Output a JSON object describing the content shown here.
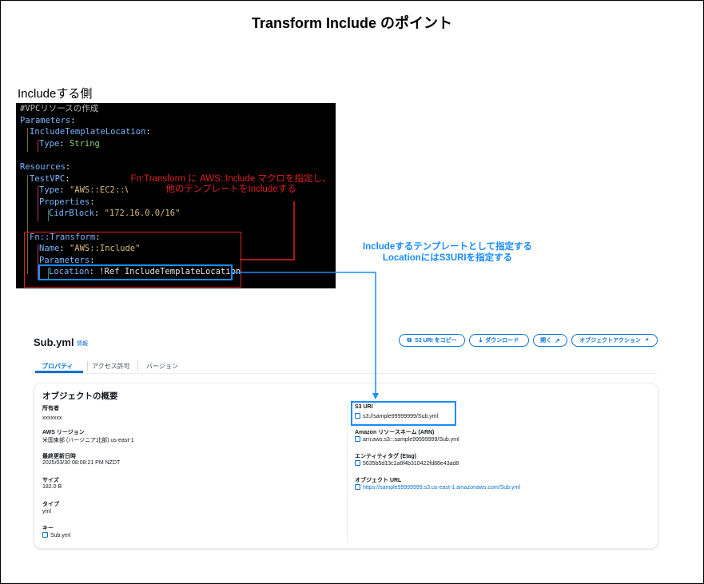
{
  "slide": {
    "title": "Transform Include のポイント",
    "subheading": "Includeする側"
  },
  "code": {
    "comment": "#VPCリソースの作成",
    "parameters_key": "Parameters",
    "include_template_location": "IncludeTemplateLocation",
    "type_key": "Type",
    "type_string": "String",
    "resources_key": "Resources",
    "test_vpc": "TestVPC",
    "vpc_type_value": "\"AWS::EC2::VPC\"",
    "properties_key": "Properties",
    "cidr_key": "CidrBlock",
    "cidr_value": "\"172.16.0.0/16\"",
    "fn_transform": "Fn::Transform",
    "name_key": "Name",
    "name_value": "\"AWS::Include\"",
    "location_key": "Location",
    "ref_tag": "!Ref",
    "ref_target": "IncludeTemplateLocation"
  },
  "annotations": {
    "red_line1": "Fn:Transform に AWS::Include マクロを指定し、",
    "red_line2": "他のテンプレートをIncludeする",
    "blue_line1": "Includeするテンプレートとして指定する",
    "blue_line2": "LocationにはS3URIを指定する"
  },
  "s3": {
    "object_name": "Sub.yml",
    "info_link": "情報",
    "buttons": {
      "copy_uri": "S3 URI をコピー",
      "download": "ダウンロード",
      "open": "開く",
      "actions": "オブジェクトアクション"
    },
    "tabs": [
      "プロパティ",
      "アクセス許可",
      "バージョン"
    ],
    "overview_title": "オブジェクトの概要",
    "left_fields": [
      {
        "label": "所有者",
        "value": "xxxxxxx"
      },
      {
        "label": "AWS リージョン",
        "value": "米国東部 (バージニア北部) us-east-1"
      },
      {
        "label": "最終更新日時",
        "value": "2025/03/30 08:08:21 PM NZDT"
      },
      {
        "label": "サイズ",
        "value": "182.0 B"
      },
      {
        "label": "タイプ",
        "value": "yml"
      },
      {
        "label": "キー",
        "value": "Sub.yml"
      }
    ],
    "right_fields": [
      {
        "label": "S3 URI",
        "value": "s3://sample99999999/Sub.yml"
      },
      {
        "label": "Amazon リソースネーム (ARN)",
        "value": "arn:aws:s3:::sample99999999/Sub.yml"
      },
      {
        "label": "エンティティタグ (Etag)",
        "value": "5635b5d13c1a8f4b310422fd88e43ad8"
      },
      {
        "label": "オブジェクト URL",
        "value": "https://sample99999999.s3.us-east-1.amazonaws.com/Sub.yml"
      }
    ]
  },
  "colors": {
    "red_annotation": "#e02020",
    "blue_annotation": "#1a8cff",
    "aws_link": "#0972d3"
  }
}
